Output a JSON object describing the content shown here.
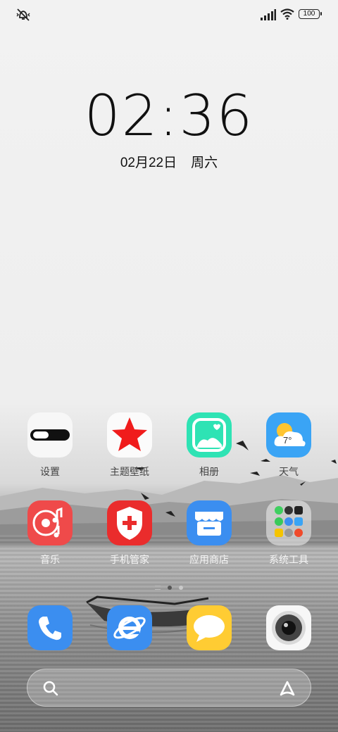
{
  "status_bar": {
    "battery": "100",
    "icons": [
      "mute-vibrate-icon",
      "signal-icon",
      "wifi-icon",
      "battery-icon"
    ]
  },
  "lockscreen": {
    "time": "02:36",
    "date": "02月22日",
    "weekday": "周六"
  },
  "apps_row1": [
    {
      "label": "设置",
      "icon": "settings-toggle-icon"
    },
    {
      "label": "主题壁纸",
      "icon": "star-icon"
    },
    {
      "label": "相册",
      "icon": "photo-heart-icon"
    },
    {
      "label": "天气",
      "icon": "weather-icon",
      "temperature": "7°"
    }
  ],
  "apps_row2": [
    {
      "label": "音乐",
      "icon": "music-disc-icon"
    },
    {
      "label": "手机管家",
      "icon": "shield-plus-icon"
    },
    {
      "label": "应用商店",
      "icon": "store-icon"
    },
    {
      "label": "系统工具",
      "icon": "folder-icon"
    }
  ],
  "dock": [
    {
      "name": "phone",
      "icon": "phone-icon"
    },
    {
      "name": "browser",
      "icon": "browser-e-icon"
    },
    {
      "name": "messages",
      "icon": "message-bubble-icon"
    },
    {
      "name": "camera",
      "icon": "camera-lens-icon"
    }
  ],
  "colors": {
    "star_red": "#f02020",
    "gallery_green": "#2ee3b4",
    "weather_blue": "#3aa4f5",
    "music_red": "#ef4a4a",
    "shield_red": "#ea2c2c",
    "store_blue": "#3b8ef0",
    "phone_blue": "#3b8ef0",
    "msg_yellow": "#ffcc33"
  }
}
